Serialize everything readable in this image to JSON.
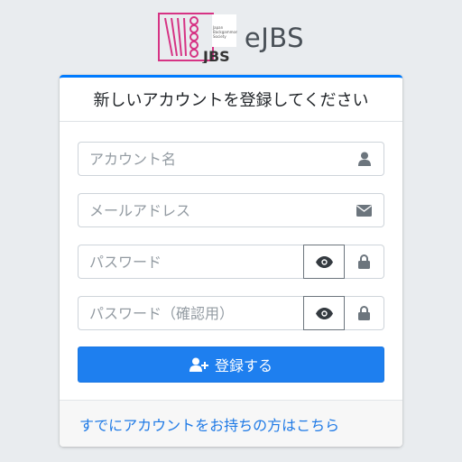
{
  "brand": {
    "logo_text": "JBS",
    "logo_small_text": "Japan Backgammon Society",
    "name": "eJBS"
  },
  "card": {
    "title": "新しいアカウントを登録してください",
    "fields": {
      "account_name": {
        "placeholder": "アカウント名",
        "icon": "user-icon"
      },
      "email": {
        "placeholder": "メールアドレス",
        "icon": "envelope-icon"
      },
      "password": {
        "placeholder": "パスワード",
        "toggle_icon": "eye-icon",
        "icon": "lock-icon"
      },
      "password_confirm": {
        "placeholder": "パスワード（確認用）",
        "toggle_icon": "eye-icon",
        "icon": "lock-icon"
      }
    },
    "submit_label": "登録する",
    "submit_icon": "user-plus-icon",
    "footer_link": "すでにアカウントをお持ちの方はこちら"
  },
  "colors": {
    "primary": "#1e7fef",
    "brand_pink": "#d63384",
    "link": "#1f7ae6",
    "background": "#e9ecef"
  }
}
